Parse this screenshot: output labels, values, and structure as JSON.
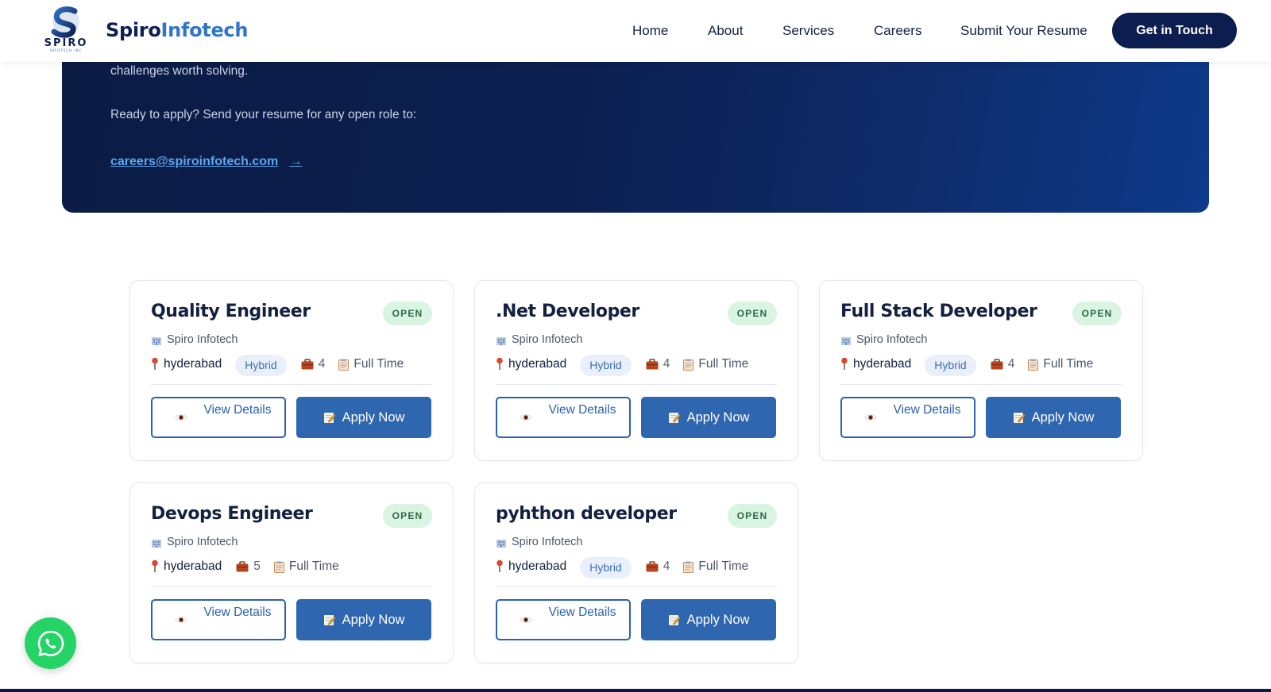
{
  "brand": {
    "logo_text_a": "Spiro",
    "logo_text_b": "Infotech",
    "logo_mark_text": "SPIRO",
    "logo_mark_sub": "INFOTECH INC"
  },
  "nav": [
    {
      "label": "Home"
    },
    {
      "label": "About"
    },
    {
      "label": "Services"
    },
    {
      "label": "Careers"
    },
    {
      "label": "Submit Your Resume"
    }
  ],
  "cta_label": "Get in Touch",
  "hero": {
    "line1": "challenges worth solving.",
    "line2": "Ready to apply? Send your resume for any open role to:",
    "email": "careers@spiroinfotech.com",
    "arrow": "→"
  },
  "jobs": [
    {
      "title": "Quality Engineer",
      "status": "OPEN",
      "company": "Spiro Infotech",
      "location": "hyderabad",
      "mode": "Hybrid",
      "count": "4",
      "type": "Full Time",
      "details_label": "View Details",
      "apply_label": "Apply Now"
    },
    {
      "title": ".Net Developer",
      "status": "OPEN",
      "company": "Spiro Infotech",
      "location": "hyderabad",
      "mode": "Hybrid",
      "count": "4",
      "type": "Full Time",
      "details_label": "View Details",
      "apply_label": "Apply Now"
    },
    {
      "title": "Full Stack Developer",
      "status": "OPEN",
      "company": "Spiro Infotech",
      "location": "hyderabad",
      "mode": "Hybrid",
      "count": "4",
      "type": "Full Time",
      "details_label": "View Details",
      "apply_label": "Apply Now"
    },
    {
      "title": "Devops Engineer",
      "status": "OPEN",
      "company": "Spiro Infotech",
      "location": "hyderabad",
      "mode": "",
      "count": "5",
      "type": "Full Time",
      "details_label": "View Details",
      "apply_label": "Apply Now"
    },
    {
      "title": "pyhthon developer",
      "status": "OPEN",
      "company": "Spiro Infotech",
      "location": "hyderabad",
      "mode": "Hybrid",
      "count": "4",
      "type": "Full Time",
      "details_label": "View Details",
      "apply_label": "Apply Now"
    }
  ],
  "icons": {
    "company": "building-icon",
    "location": "location-pin-icon",
    "openings": "briefcase-icon",
    "job_type": "clipboard-icon",
    "view": "eye-icon",
    "apply": "pencil-icon",
    "whatsapp": "whatsapp-icon"
  },
  "colors": {
    "navy": "#0c1d4f",
    "brand_blue": "#2f75c9",
    "apply_blue": "#2e66b0",
    "open_badge_bg": "#d9f4e2",
    "whatsapp_green": "#25d366"
  }
}
